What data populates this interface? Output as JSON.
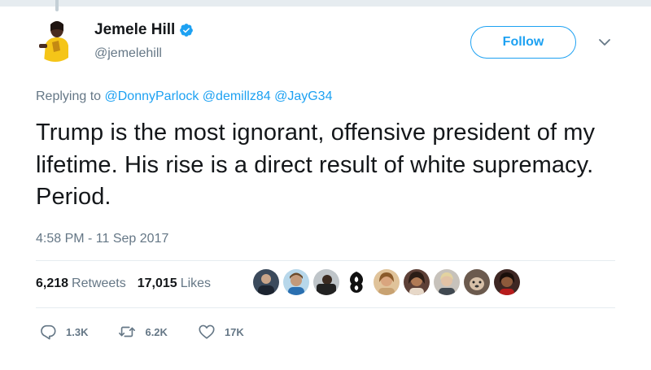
{
  "author": {
    "name": "Jemele Hill",
    "handle": "@jemelehill",
    "avatar_icon": "profile-photo",
    "verified_icon": "verified-badge-icon"
  },
  "follow_button": {
    "label": "Follow"
  },
  "menu": {
    "icon": "chevron-down-icon"
  },
  "reply_context": {
    "prefix": "Replying to",
    "mentions": [
      "@DonnyParlock",
      "@demillz84",
      "@JayG34"
    ]
  },
  "tweet": {
    "text": "Trump is the most ignorant, offensive president of my lifetime. His rise is a direct result of white supremacy. Period.",
    "timestamp": "4:58 PM - 11 Sep 2017"
  },
  "stats": {
    "retweets_count": "6,218",
    "retweets_label": "Retweets",
    "likes_count": "17,015",
    "likes_label": "Likes"
  },
  "likers": [
    {
      "icon": "liker-avatar-1",
      "color": "#3b4a5c"
    },
    {
      "icon": "liker-avatar-2",
      "color": "#8d6e63"
    },
    {
      "icon": "liker-avatar-3",
      "color": "#2e2e2e"
    },
    {
      "icon": "liker-avatar-4",
      "color": "#111111"
    },
    {
      "icon": "liker-avatar-5",
      "color": "#d7b48a"
    },
    {
      "icon": "liker-avatar-6",
      "color": "#6d4c41"
    },
    {
      "icon": "liker-avatar-7",
      "color": "#b0a090"
    },
    {
      "icon": "liker-avatar-8",
      "color": "#7a5a48"
    },
    {
      "icon": "liker-avatar-9",
      "color": "#4e342e"
    }
  ],
  "actions": {
    "reply_count": "1.3K",
    "retweet_count": "6.2K",
    "like_count": "17K"
  },
  "colors": {
    "accent": "#1da1f2",
    "secondary_text": "#657786",
    "primary_text": "#14171a",
    "divider": "#e6ecf0"
  }
}
